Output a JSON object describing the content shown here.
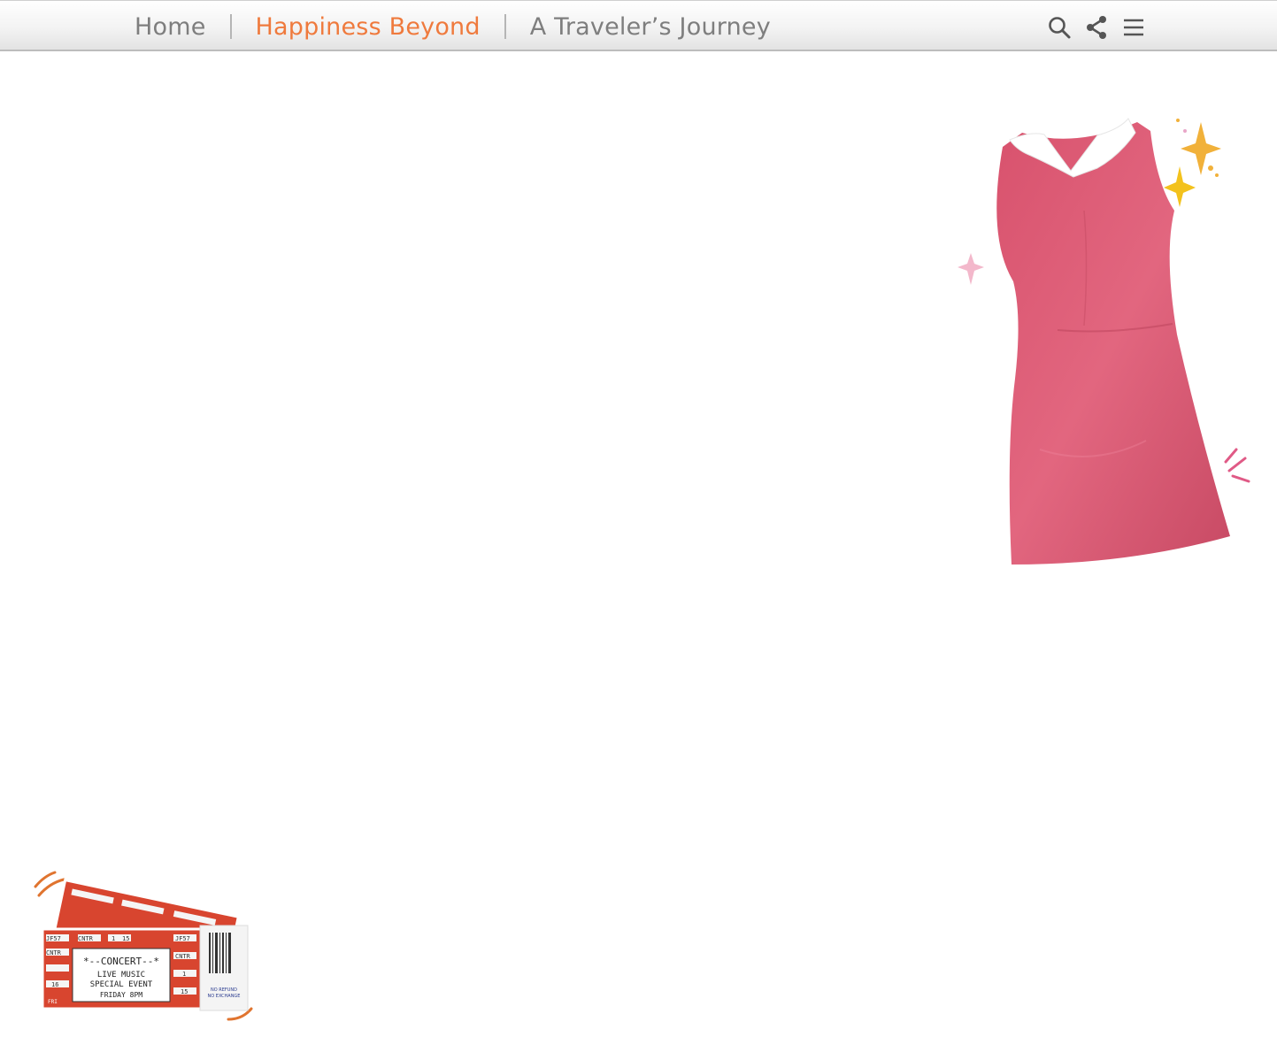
{
  "nav": {
    "items": [
      {
        "label": "Home",
        "active": false
      },
      {
        "label": "Happiness Beyond",
        "active": true
      },
      {
        "label": "A Traveler’s Journey",
        "active": false
      }
    ]
  },
  "toolbar": {
    "icons": [
      "search-icon",
      "share-icon",
      "menu-icon"
    ]
  },
  "colors": {
    "accent": "#ef7a3d",
    "nav_text": "#7e7e7e",
    "dress": "#e0637c",
    "ticket": "#d8452f"
  },
  "ticket": {
    "code": "JF57",
    "section": "CNTR",
    "row_seat_1": "1",
    "row_seat_2": "15",
    "row_seat_3": "16",
    "headline": "*--CONCERT--*",
    "line1": "LIVE MUSIC",
    "line2": "SPECIAL EVENT",
    "line3": "FRIDAY 8PM",
    "stub_day": "FRI",
    "refund_1": "NO REFUND",
    "refund_2": "NO EXCHANGE"
  }
}
